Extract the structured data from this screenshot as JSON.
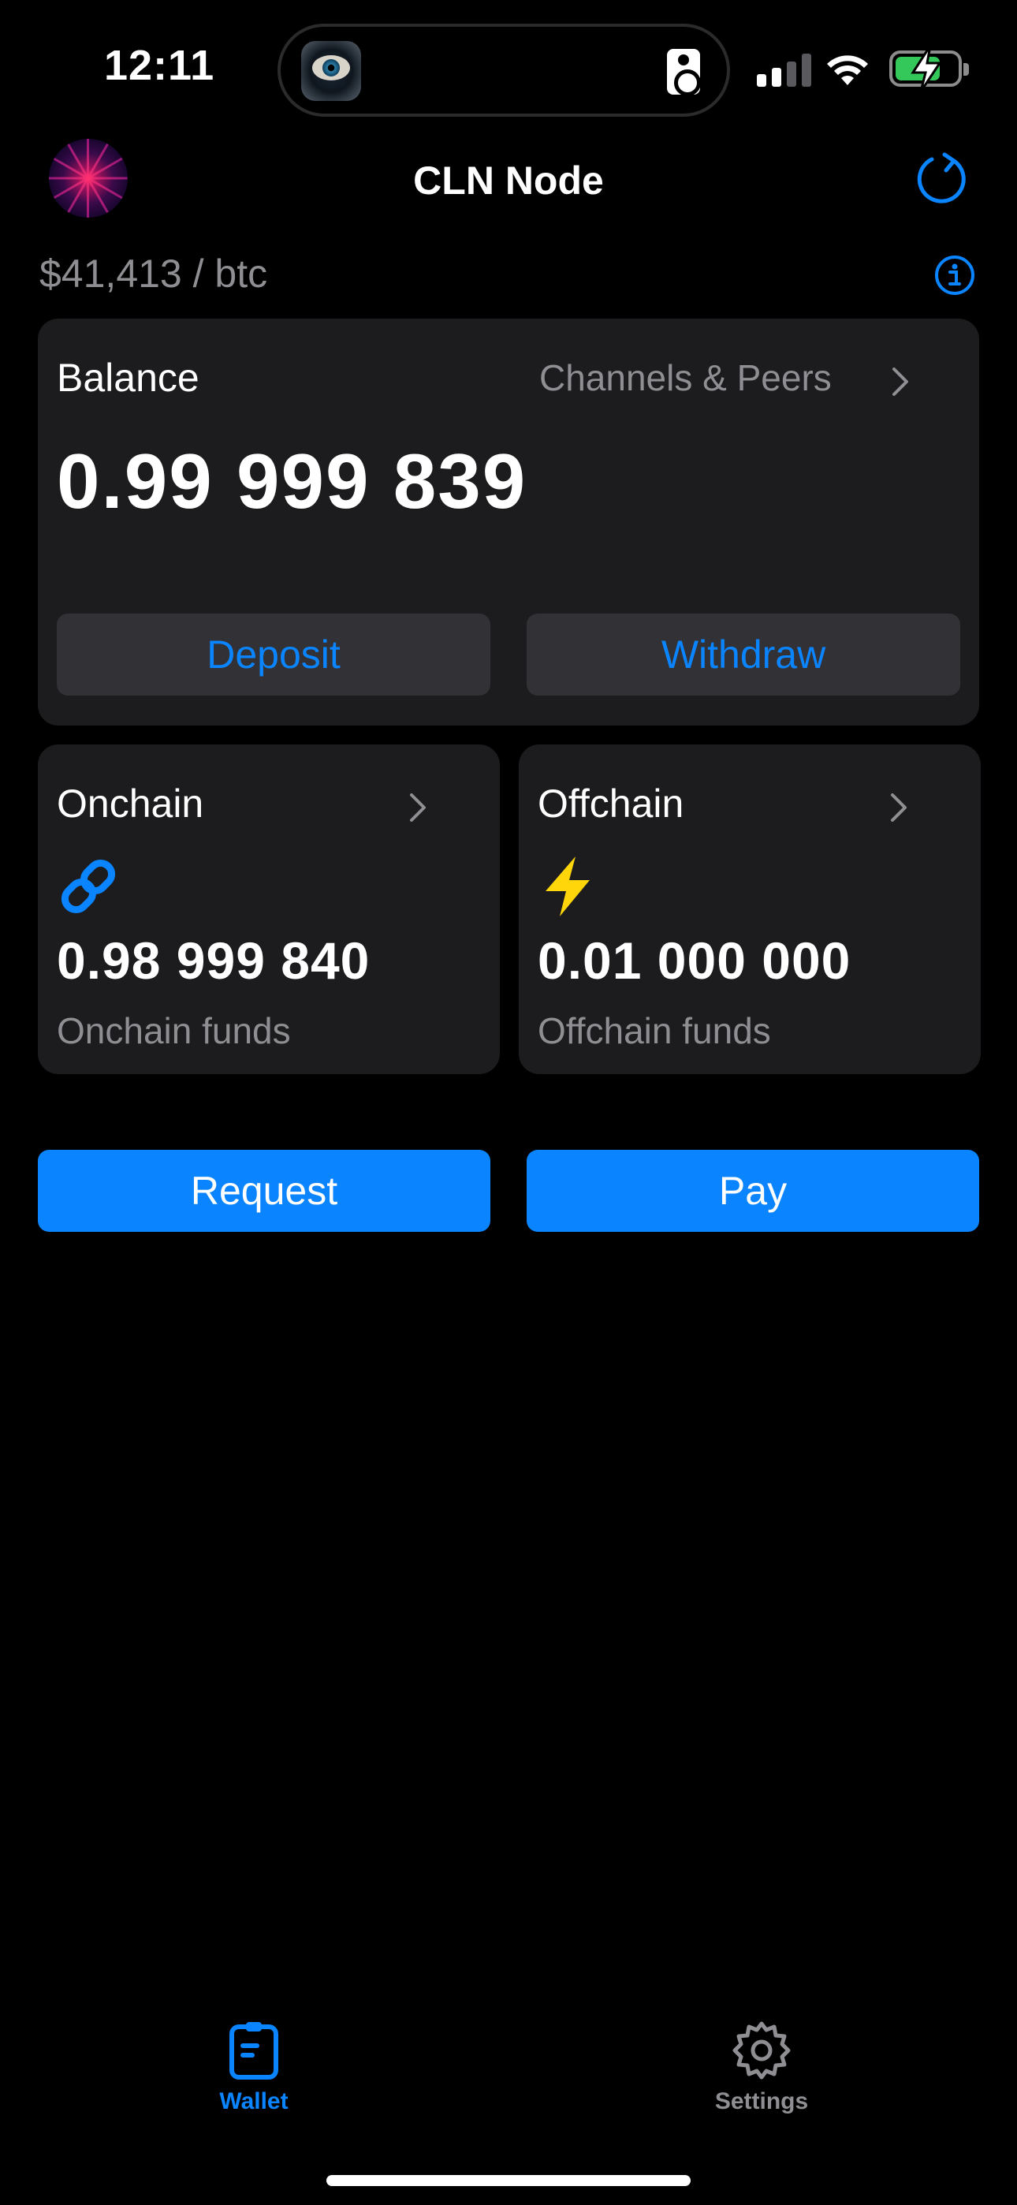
{
  "status_bar": {
    "time": "12:11"
  },
  "header": {
    "title": "CLN Node",
    "price": "$41,413 / btc"
  },
  "balance_card": {
    "label": "Balance",
    "channels_link": "Channels & Peers",
    "amount": "0.99 999 839",
    "deposit_label": "Deposit",
    "withdraw_label": "Withdraw"
  },
  "onchain_card": {
    "label": "Onchain",
    "icon": "link-icon",
    "amount": "0.98 999 840",
    "subtitle": "Onchain funds"
  },
  "offchain_card": {
    "label": "Offchain",
    "icon": "lightning-icon",
    "amount": "0.01 000 000",
    "subtitle": "Offchain funds"
  },
  "actions": {
    "request_label": "Request",
    "pay_label": "Pay"
  },
  "tab_bar": {
    "tabs": [
      {
        "label": "Wallet",
        "icon": "wallet-icon",
        "active": true
      },
      {
        "label": "Settings",
        "icon": "gear-icon",
        "active": false
      }
    ]
  },
  "colors": {
    "accent": "#0a84ff",
    "card_bg": "#1c1c1e",
    "secondary_text": "#8e8e93",
    "lightning": "#ffd60a"
  }
}
